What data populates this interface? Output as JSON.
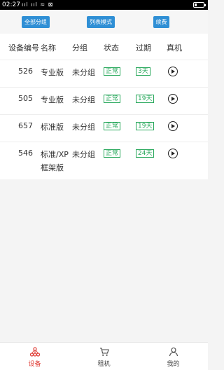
{
  "status_bar": {
    "time": "02:27",
    "signal_text": "ııl ııl ≈ ⊠"
  },
  "toolbar": {
    "all_groups_label": "全部分组",
    "list_mode_label": "列表模式",
    "renew_label": "续费"
  },
  "table": {
    "headers": {
      "device_no": "设备编号",
      "name": "名称",
      "group": "分组",
      "status": "状态",
      "expire": "过期",
      "real": "真机"
    },
    "rows": [
      {
        "id": "526",
        "name_line1": "专业版",
        "name_line2": "",
        "group": "未分组",
        "status": "正常",
        "expire": "3天"
      },
      {
        "id": "505",
        "name_line1": "专业版",
        "name_line2": "",
        "group": "未分组",
        "status": "正常",
        "expire": "19天"
      },
      {
        "id": "657",
        "name_line1": "标准版",
        "name_line2": "",
        "group": "未分组",
        "status": "正常",
        "expire": "19天"
      },
      {
        "id": "546",
        "name_line1": "标准/XP",
        "name_line2": "框架版",
        "group": "未分组",
        "status": "正常",
        "expire": "24天"
      }
    ]
  },
  "tabbar": {
    "tabs": [
      {
        "label": "设备",
        "icon": "device-tree-icon",
        "active": true
      },
      {
        "label": "租机",
        "icon": "cart-icon",
        "active": false
      },
      {
        "label": "我的",
        "icon": "user-icon",
        "active": false
      }
    ]
  },
  "colors": {
    "accent_blue": "#2f8fd5",
    "status_green": "#29a85c",
    "active_red": "#e0413a"
  }
}
